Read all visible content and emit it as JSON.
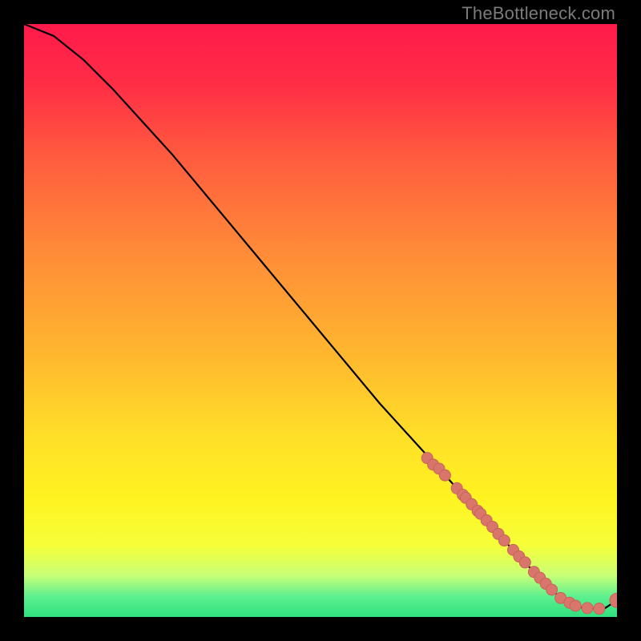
{
  "watermark": "TheBottleneck.com",
  "colors": {
    "gradient_stops": [
      {
        "pos": 0.0,
        "color": "#ff1a4b"
      },
      {
        "pos": 0.1,
        "color": "#ff2d46"
      },
      {
        "pos": 0.22,
        "color": "#ff5a3f"
      },
      {
        "pos": 0.38,
        "color": "#ff8a38"
      },
      {
        "pos": 0.55,
        "color": "#ffb52f"
      },
      {
        "pos": 0.7,
        "color": "#ffe028"
      },
      {
        "pos": 0.8,
        "color": "#fff321"
      },
      {
        "pos": 0.88,
        "color": "#f6ff3a"
      },
      {
        "pos": 0.93,
        "color": "#c8ff77"
      },
      {
        "pos": 0.965,
        "color": "#5ef08f"
      },
      {
        "pos": 1.0,
        "color": "#2fe07f"
      }
    ],
    "line": "#000000",
    "marker_fill": "#d9766c",
    "marker_stroke": "#c8635a",
    "background": "#000000"
  },
  "chart_data": {
    "type": "line",
    "title": "",
    "xlabel": "",
    "ylabel": "",
    "xlim": [
      0,
      100
    ],
    "ylim": [
      0,
      100
    ],
    "grid": false,
    "legend": false,
    "series": [
      {
        "name": "curve",
        "x": [
          0,
          5,
          10,
          15,
          20,
          25,
          30,
          35,
          40,
          45,
          50,
          55,
          60,
          65,
          70,
          75,
          80,
          82,
          84,
          86,
          88,
          90,
          92,
          94,
          96,
          98,
          100
        ],
        "y": [
          100,
          98,
          94,
          89,
          83.5,
          78,
          72,
          66,
          60,
          54,
          48,
          42,
          36,
          30.5,
          25,
          19.5,
          14,
          11.8,
          9.7,
          7.6,
          5.6,
          3.7,
          2.4,
          1.6,
          1.4,
          1.5,
          2.8
        ]
      }
    ],
    "markers": {
      "name": "points",
      "x": [
        68,
        69,
        70,
        71,
        73,
        74,
        74.5,
        75.5,
        76.5,
        77,
        78,
        79,
        80,
        81,
        82.5,
        83.5,
        84.5,
        86,
        87,
        88,
        89,
        90.5,
        92,
        93,
        95,
        97,
        100
      ],
      "y": [
        26.8,
        25.7,
        25.0,
        23.9,
        21.7,
        20.6,
        20.1,
        19.0,
        17.9,
        17.4,
        16.3,
        15.2,
        14.0,
        12.9,
        11.3,
        10.2,
        9.2,
        7.6,
        6.6,
        5.6,
        4.6,
        3.2,
        2.4,
        1.9,
        1.5,
        1.4,
        2.8
      ]
    },
    "marker_radii": [
      7,
      7,
      7,
      7,
      7,
      7,
      7,
      7,
      7,
      7,
      7,
      7,
      7,
      7,
      7,
      7,
      7,
      7,
      7,
      7,
      7,
      7,
      7,
      7,
      7,
      7,
      9
    ]
  }
}
